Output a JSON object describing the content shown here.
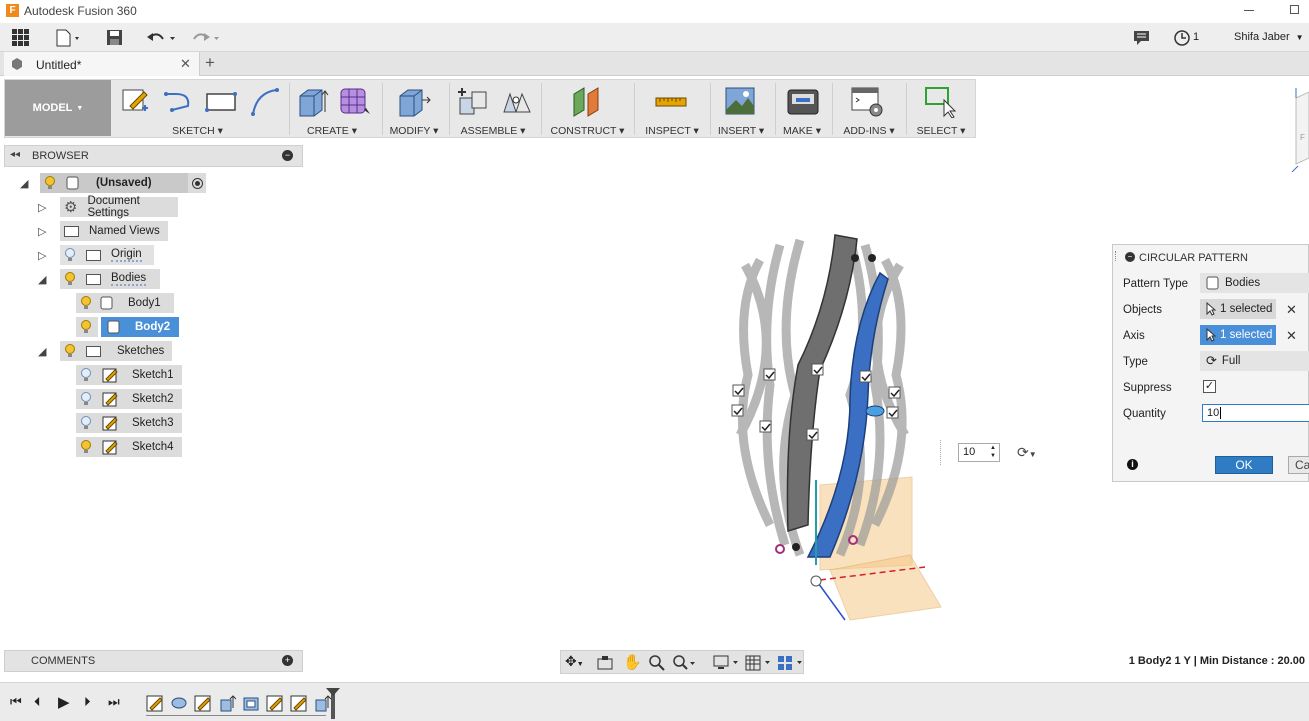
{
  "app": {
    "title": "Autodesk Fusion 360"
  },
  "header": {
    "notifications_count": "1",
    "user_name": "Shifa Jaber"
  },
  "document": {
    "tab_title": "Untitled*"
  },
  "ribbon": {
    "workspace": "MODEL",
    "groups": [
      "SKETCH",
      "CREATE",
      "MODIFY",
      "ASSEMBLE",
      "CONSTRUCT",
      "INSPECT",
      "INSERT",
      "MAKE",
      "ADD-INS",
      "SELECT"
    ]
  },
  "browser": {
    "title": "BROWSER",
    "root": "(Unsaved)",
    "items": {
      "document_settings": "Document Settings",
      "named_views": "Named Views",
      "origin": "Origin",
      "bodies": "Bodies",
      "body1": "Body1",
      "body2": "Body2",
      "sketches": "Sketches",
      "sketch1": "Sketch1",
      "sketch2": "Sketch2",
      "sketch3": "Sketch3",
      "sketch4": "Sketch4"
    }
  },
  "comments": {
    "title": "COMMENTS"
  },
  "viewport": {
    "quantity_value": "10"
  },
  "dialog": {
    "title": "CIRCULAR PATTERN",
    "pattern_type_label": "Pattern Type",
    "pattern_type_value": "Bodies",
    "objects_label": "Objects",
    "objects_value": "1 selected",
    "axis_label": "Axis",
    "axis_value": "1 selected",
    "type_label": "Type",
    "type_value": "Full",
    "suppress_label": "Suppress",
    "quantity_label": "Quantity",
    "quantity_value": "10",
    "ok_label": "OK",
    "cancel_label": "Ca"
  },
  "status": {
    "text": "1 Body2 1 Y | Min Distance : 20.00"
  },
  "colors": {
    "accent": "#2f7bc4",
    "selection": "#4a90d9",
    "body_blue": "#3a6fc4"
  }
}
